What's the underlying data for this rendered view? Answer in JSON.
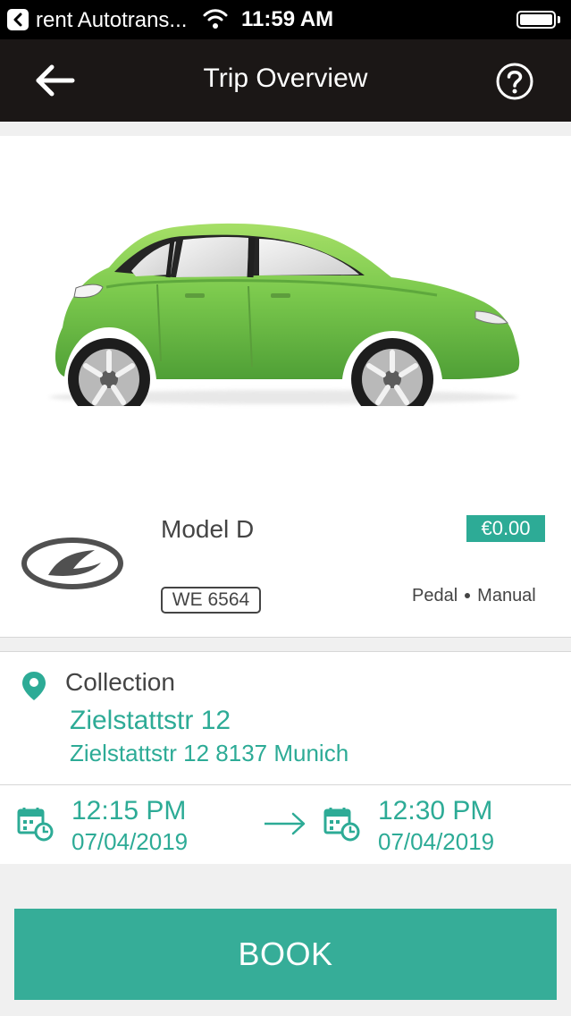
{
  "status_bar": {
    "app_name": "rent Autotrans...",
    "time": "11:59 AM"
  },
  "header": {
    "title": "Trip Overview"
  },
  "vehicle": {
    "model": "Model D",
    "plate": "WE 6564",
    "price": "€0.00",
    "features": [
      "Pedal",
      "Manual"
    ],
    "color": "#7bc94d"
  },
  "collection": {
    "label": "Collection",
    "name": "Zielstattstr 12",
    "address": "Zielstattstr 12 8137 Munich"
  },
  "schedule": {
    "start_time": "12:15 PM",
    "start_date": "07/04/2019",
    "end_time": "12:30 PM",
    "end_date": "07/04/2019"
  },
  "actions": {
    "book_label": "BOOK"
  },
  "colors": {
    "accent": "#2dab96",
    "navbar": "#1b1716"
  },
  "icons": [
    "back-arrow-icon",
    "help-icon",
    "location-pin-icon",
    "calendar-clock-icon",
    "arrow-right-icon",
    "hyundai-logo",
    "wifi-icon",
    "battery-icon"
  ]
}
